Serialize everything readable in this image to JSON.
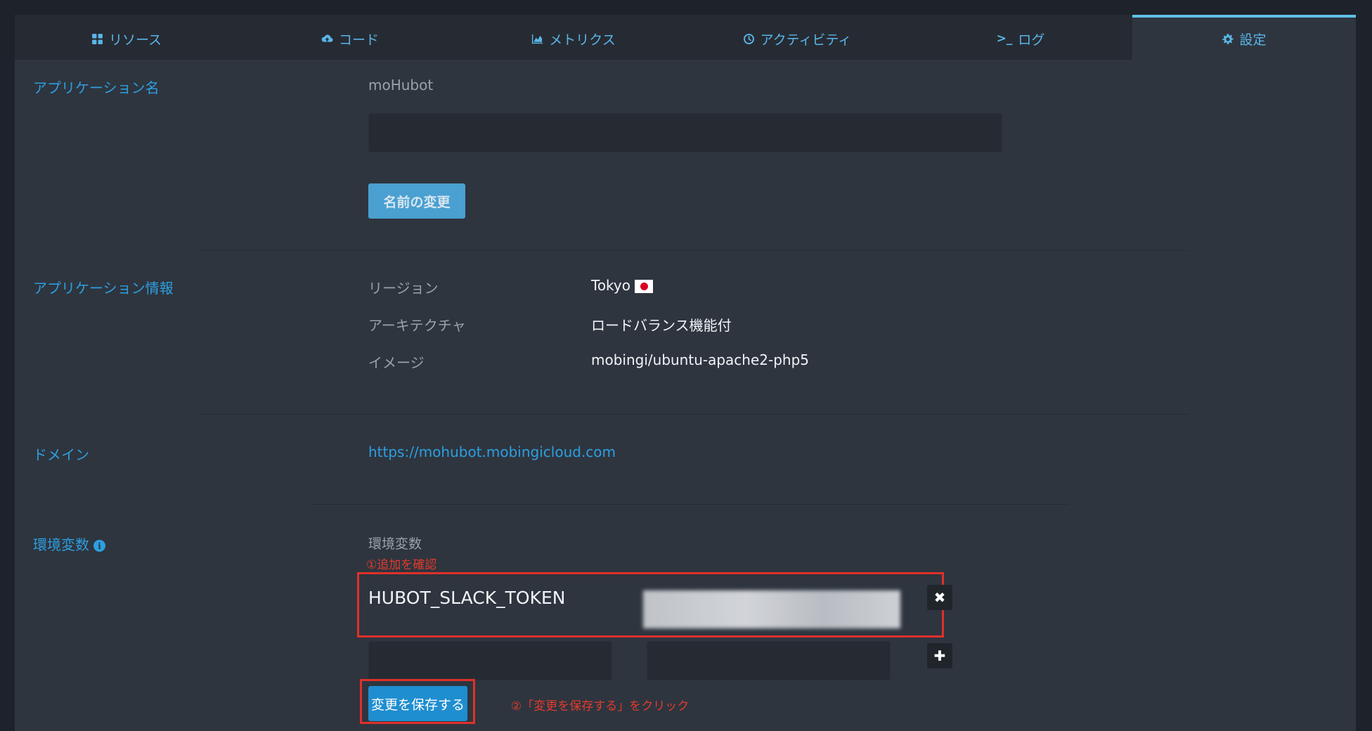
{
  "tabs": [
    {
      "label": "リソース",
      "icon": "grid-icon",
      "active": false
    },
    {
      "label": "コード",
      "icon": "cloud-upload-icon",
      "active": false
    },
    {
      "label": "メトリクス",
      "icon": "area-chart-icon",
      "active": false
    },
    {
      "label": "アクティビティ",
      "icon": "clock-icon",
      "active": false
    },
    {
      "label": "ログ",
      "icon": "terminal-icon",
      "glyph": ">_",
      "active": false
    },
    {
      "label": "設定",
      "icon": "gear-icon",
      "active": true
    }
  ],
  "app_name": {
    "label": "アプリケーション名",
    "current": "moHubot",
    "input_value": "",
    "button": "名前の変更"
  },
  "app_info": {
    "label": "アプリケーション情報",
    "rows": [
      {
        "key": "リージョン",
        "value": "Tokyo",
        "flag": "japan-flag-icon"
      },
      {
        "key": "アーキテクチャ",
        "value": "ロードバランス機能付"
      },
      {
        "key": "イメージ",
        "value": "mobingi/ubuntu-apache2-php5"
      }
    ]
  },
  "domain": {
    "label": "ドメイン",
    "url": "https://mohubot.mobingicloud.com"
  },
  "env": {
    "label": "環境変数",
    "sub_label": "環境変数",
    "annotation_1": "①追加を確認",
    "annotation_2": "②「変更を保存する」をクリック",
    "var_key": "HUBOT_SLACK_TOKEN",
    "new_key": "",
    "new_value": "",
    "remove": "✖",
    "add": "✚",
    "save_button": "変更を保存する",
    "info_glyph": "i"
  },
  "colors": {
    "accent": "#2d9fe0",
    "active_tab_border": "#5fc0e6",
    "annotation_red": "#e0302a",
    "save_button": "#1f8ed0"
  }
}
